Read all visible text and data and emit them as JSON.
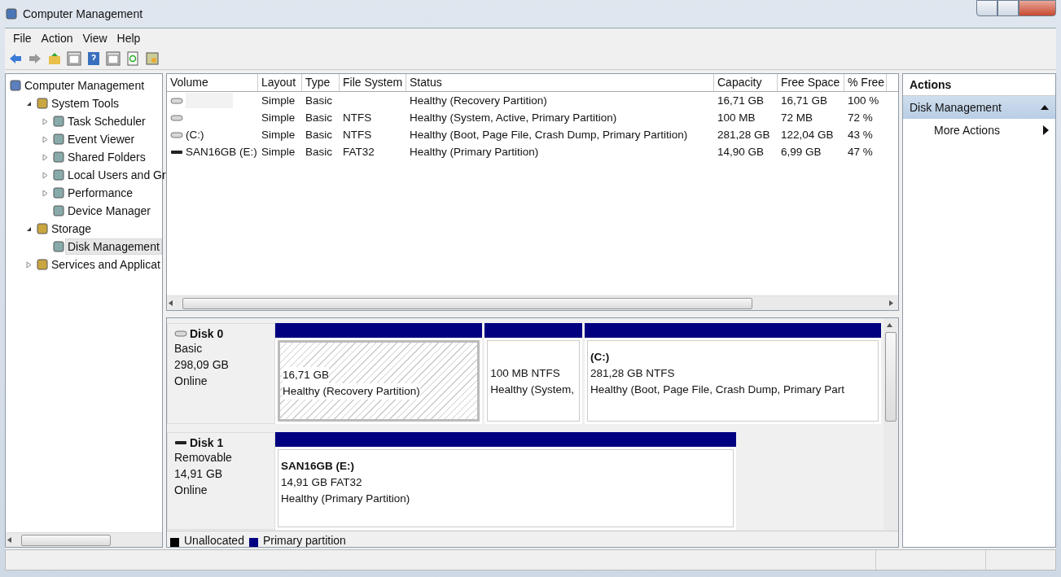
{
  "window": {
    "title": "Computer Management"
  },
  "menu": [
    "File",
    "Action",
    "View",
    "Help"
  ],
  "tree": [
    {
      "label": "Computer Management",
      "selected": false,
      "children": [
        {
          "label": "System Tools",
          "expanded": true,
          "selected": false,
          "children": [
            {
              "label": "Task Scheduler",
              "expanded": false,
              "selected": false
            },
            {
              "label": "Event Viewer",
              "expanded": false,
              "selected": false
            },
            {
              "label": "Shared Folders",
              "expanded": false,
              "selected": false
            },
            {
              "label": "Local Users and Gr",
              "expanded": false,
              "selected": false
            },
            {
              "label": "Performance",
              "expanded": false,
              "selected": false
            },
            {
              "label": "Device Manager",
              "selected": false
            }
          ]
        },
        {
          "label": "Storage",
          "expanded": true,
          "selected": false,
          "children": [
            {
              "label": "Disk Management",
              "selected": true
            }
          ]
        },
        {
          "label": "Services and Applicat",
          "expanded": false,
          "selected": false
        }
      ]
    }
  ],
  "table": {
    "columns": [
      "Volume",
      "Layout",
      "Type",
      "File System",
      "Status",
      "Capacity",
      "Free Space",
      "% Free"
    ],
    "rows": [
      {
        "kind": "fixed",
        "cells": [
          "",
          "Simple",
          "Basic",
          "",
          "Healthy (Recovery Partition)",
          "16,71 GB",
          "16,71 GB",
          "100 %"
        ],
        "redacted": true
      },
      {
        "kind": "fixed",
        "cells": [
          "",
          "Simple",
          "Basic",
          "NTFS",
          "Healthy (System, Active, Primary Partition)",
          "100 MB",
          "72 MB",
          "72 %"
        ],
        "redacted": false
      },
      {
        "kind": "fixed",
        "cells": [
          "(C:)",
          "Simple",
          "Basic",
          "NTFS",
          "Healthy (Boot, Page File, Crash Dump, Primary Partition)",
          "281,28 GB",
          "122,04 GB",
          "43 %"
        ],
        "redacted": false
      },
      {
        "kind": "removable",
        "cells": [
          "SAN16GB (E:)",
          "Simple",
          "Basic",
          "FAT32",
          "Healthy (Primary Partition)",
          "14,90 GB",
          "6,99 GB",
          "47 %"
        ],
        "redacted": false
      }
    ]
  },
  "disks": [
    {
      "kind": "fixed",
      "name": "Disk 0",
      "type": "Basic",
      "size": "298,09 GB",
      "status": "Online",
      "partitions": [
        {
          "size": "16,71 GB",
          "status": "Healthy (Recovery Partition)",
          "selected": true
        },
        {
          "size": "100 MB NTFS",
          "status": "Healthy (System,",
          "selected": false
        },
        {
          "title": "(C:)",
          "size": "281,28 GB NTFS",
          "status": "Healthy (Boot, Page File, Crash Dump, Primary Part",
          "selected": false
        }
      ]
    },
    {
      "kind": "removable",
      "name": "Disk 1",
      "type": "Removable",
      "size": "14,91 GB",
      "status": "Online",
      "partitions": [
        {
          "title": "SAN16GB  (E:)",
          "size": "14,91 GB FAT32",
          "status": "Healthy (Primary Partition)",
          "selected": false
        }
      ]
    }
  ],
  "legend": [
    {
      "label": "Unallocated",
      "color": "#000000"
    },
    {
      "label": "Primary partition",
      "color": "#000080"
    }
  ],
  "actions": {
    "title": "Actions",
    "section": "Disk Management",
    "items": [
      "More Actions"
    ]
  }
}
